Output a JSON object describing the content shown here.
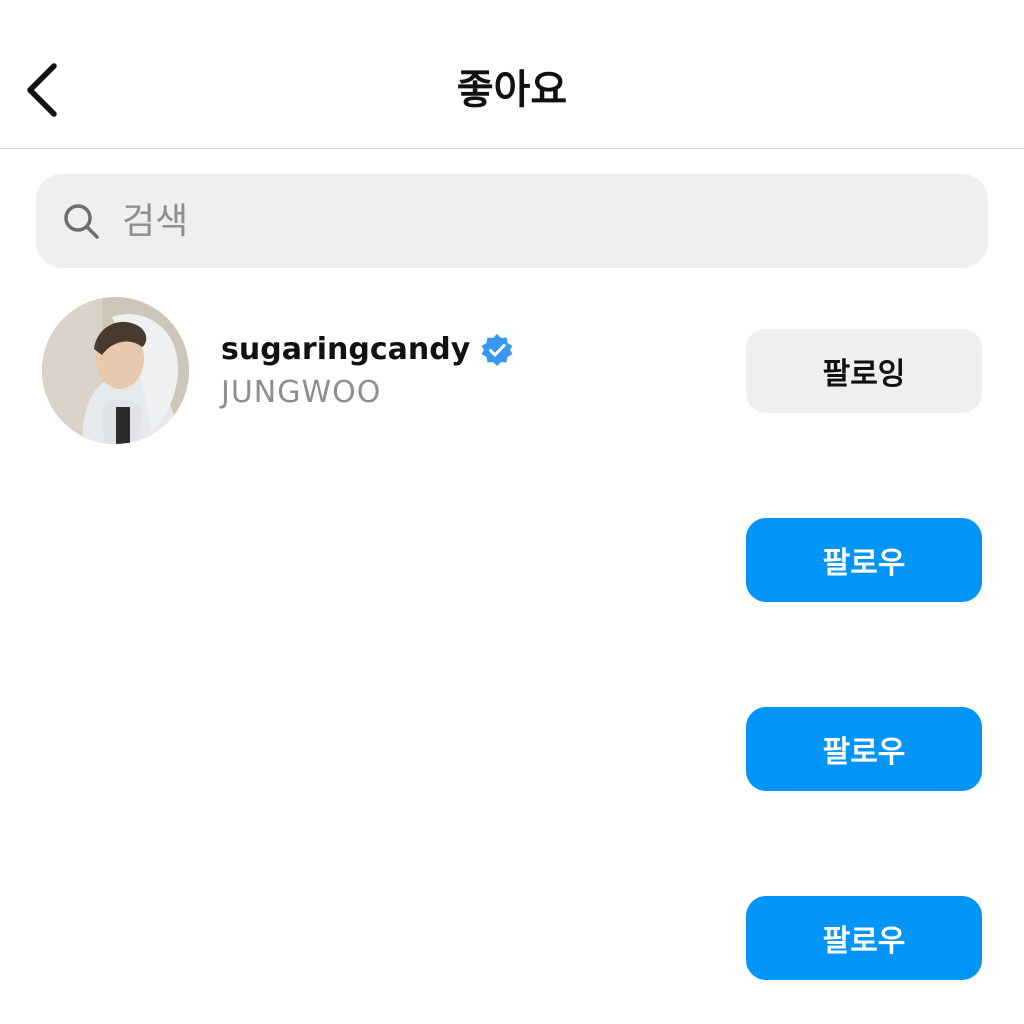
{
  "header": {
    "title": "좋아요",
    "back_icon": "chevron-left-icon"
  },
  "search": {
    "placeholder": "검색",
    "icon": "search-icon"
  },
  "users": [
    {
      "username": "sugaringcandy",
      "full_name": "JUNGWOO",
      "verified": true,
      "button_label": "팔로잉",
      "following": true
    },
    {
      "username": "",
      "full_name": "",
      "button_label": "팔로우",
      "following": false
    },
    {
      "username": "",
      "full_name": "",
      "button_label": "팔로우",
      "following": false
    },
    {
      "username": "",
      "full_name": "",
      "button_label": "팔로우",
      "following": false
    }
  ],
  "colors": {
    "follow_button": "#0095f6",
    "following_button": "#efefef",
    "verified_badge": "#3897f0",
    "secondary_text": "#8e8e8e"
  }
}
